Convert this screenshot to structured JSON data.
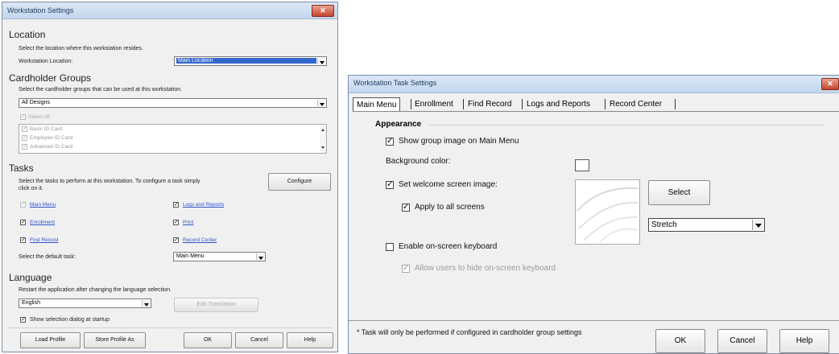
{
  "left_window": {
    "title": "Workstation Settings",
    "close_glyph": "✕",
    "location": {
      "header": "Location",
      "description": "Select the location where this workstation resides.",
      "field_label": "Workstation Location:",
      "value": "Main Location"
    },
    "cardholder_groups": {
      "header": "Cardholder Groups",
      "description": "Select the cardholder groups that can be used at this workstation.",
      "dropdown_value": "All Designs",
      "select_all_label": "Select All",
      "items": [
        "Basic ID Card",
        "Employee ID Card",
        "Advanced ID Card"
      ]
    },
    "tasks": {
      "header": "Tasks",
      "description_line1": "Select the tasks to perform at this workstation. To configure a task simply",
      "description_line2": "click on it.",
      "configure_label": "Configure",
      "task_items": [
        {
          "label": "Main Menu",
          "checked": false
        },
        {
          "label": "Logs and Reports",
          "checked": true
        },
        {
          "label": "Enrollment",
          "checked": true
        },
        {
          "label": "Print",
          "checked": true
        },
        {
          "label": "Find Record",
          "checked": true
        },
        {
          "label": "Record Center",
          "checked": true
        }
      ],
      "default_task_label": "Select the default task:",
      "default_task_value": "Main Menu"
    },
    "language": {
      "header": "Language",
      "description": "Restart the application after changing the language selection.",
      "value": "English",
      "edit_translation_label": "Edit Translation",
      "show_dialog_label": "Show selection dialog at startup"
    },
    "buttons": {
      "load_profile": "Load Profile",
      "store_profile_as": "Store Profile As",
      "ok": "OK",
      "cancel": "Cancel",
      "help": "Help"
    }
  },
  "right_window": {
    "title": "Workstation Task Settings",
    "close_glyph": "✕",
    "tabs": [
      "Main Menu",
      "Enrollment",
      "Find Record",
      "Logs and Reports",
      "Record Center"
    ],
    "selected_tab": "Main Menu",
    "appearance": {
      "header": "Appearance",
      "show_group_image_label": "Show group image on Main Menu",
      "background_color_label": "Background color:",
      "set_welcome_image_label": "Set welcome screen image:",
      "apply_all_label": "Apply to all screens",
      "select_button_label": "Select",
      "stretch_value": "Stretch",
      "enable_keyboard_label": "Enable on-screen keyboard",
      "allow_hide_keyboard_label": "Allow users to hide on-screen keyboard"
    },
    "footer_note": "* Task will only be performed if configured in cardholder group settings",
    "buttons": {
      "ok": "OK",
      "cancel": "Cancel",
      "help": "Help"
    }
  }
}
